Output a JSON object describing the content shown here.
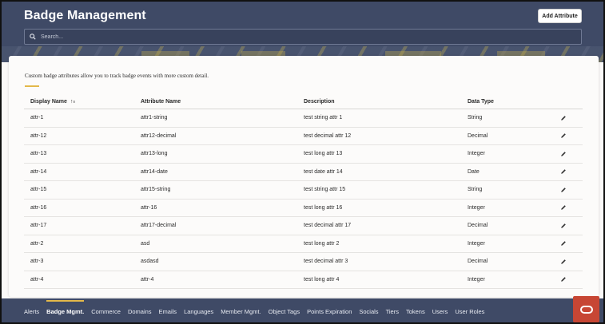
{
  "header": {
    "title": "Badge Management",
    "add_button": "Add Attribute",
    "search_placeholder": "Search..."
  },
  "content": {
    "description": "Custom badge attributes allow you to track badge events with more custom detail."
  },
  "table": {
    "columns": [
      "Display Name",
      "Attribute Name",
      "Description",
      "Data Type"
    ],
    "rows": [
      [
        "attr-1",
        "attr1-string",
        "test string attr 1",
        "String"
      ],
      [
        "attr-12",
        "attr12-decimal",
        "test decimal attr 12",
        "Decimal"
      ],
      [
        "attr-13",
        "attr13-long",
        "test long attr 13",
        "Integer"
      ],
      [
        "attr-14",
        "attr14-date",
        "test date attr 14",
        "Date"
      ],
      [
        "attr-15",
        "attr15-string",
        "test string attr 15",
        "String"
      ],
      [
        "attr-16",
        "attr-16",
        "test long attr 16",
        "Integer"
      ],
      [
        "attr-17",
        "attr17-decimal",
        "test decimal attr 17",
        "Decimal"
      ],
      [
        "attr-2",
        "asd",
        "test long attr 2",
        "Integer"
      ],
      [
        "attr-3",
        "asdasd",
        "test decimal attr 3",
        "Decimal"
      ],
      [
        "attr-4",
        "attr-4",
        "test long attr 4",
        "Integer"
      ]
    ]
  },
  "bottom_nav": {
    "tabs": [
      "Alerts",
      "Badge Mgmt.",
      "Commerce",
      "Domains",
      "Emails",
      "Languages",
      "Member Mgmt.",
      "Object Tags",
      "Points Expiration",
      "Socials",
      "Tiers",
      "Tokens",
      "Users",
      "User Roles"
    ],
    "active_index": 1
  },
  "colors": {
    "header_bg": "#3f4a66",
    "accent": "#e3b84a",
    "brand": "#c74634"
  },
  "icons": {
    "search": "search-icon",
    "sort": "sort-ascending-icon",
    "edit": "pencil-icon",
    "brand": "oracle-logo-icon"
  }
}
